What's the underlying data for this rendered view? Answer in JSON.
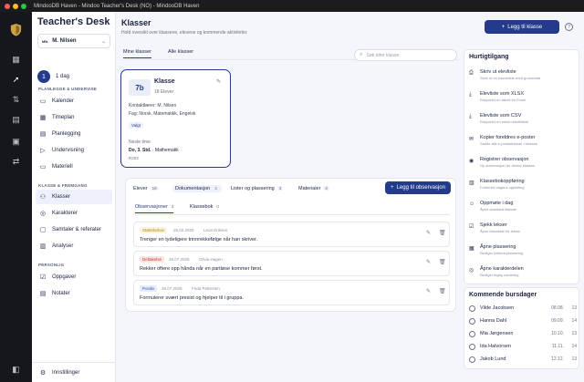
{
  "window": {
    "title": "MindooDB Haven - Mindoo Teacher's Desk (NO) - MindooDB Haven"
  },
  "colors": {
    "accent": "#243b8c",
    "tag_warning": "#b8860b",
    "tag_danger": "#c0392b",
    "tag_positive": "#2e4fb8"
  },
  "rail": {
    "logo": "shield-logo",
    "icons": [
      "grid-icon",
      "rocket-icon",
      "transfer-icon",
      "clipboard-icon",
      "inbox-icon",
      "swap-icon",
      "sidebar-toggle-icon"
    ]
  },
  "sidebar": {
    "brand_prefix": "Teacher's",
    "brand_suffix": "Desk",
    "user": {
      "initials": "MN",
      "name": "M. Nilsen"
    },
    "day": {
      "icon": "1",
      "label": "1 dag"
    },
    "sections": [
      {
        "title": "PLANLEGGE & UNDERVISE",
        "items": [
          {
            "label": "Kalender",
            "icon": "calendar-icon"
          },
          {
            "label": "Timeplan",
            "icon": "table-icon"
          },
          {
            "label": "Planlegging",
            "icon": "clipboard-icon"
          },
          {
            "label": "Undervisning",
            "icon": "play-icon"
          },
          {
            "label": "Materiell",
            "icon": "folder-icon"
          }
        ]
      },
      {
        "title": "KLASSE & FREMGANG",
        "items": [
          {
            "label": "Klasser",
            "icon": "users-icon",
            "active": true
          },
          {
            "label": "Karakterer",
            "icon": "grade-icon"
          },
          {
            "label": "Samtaler & referater",
            "icon": "chat-icon"
          },
          {
            "label": "Analyser",
            "icon": "chart-icon"
          }
        ]
      },
      {
        "title": "PERSONLIG",
        "items": [
          {
            "label": "Oppgaver",
            "icon": "check-icon"
          },
          {
            "label": "Notater",
            "icon": "note-icon"
          }
        ]
      }
    ],
    "footer": {
      "label": "Innstillinger",
      "icon": "gear-icon"
    }
  },
  "main": {
    "title": "Klasser",
    "subtitle": "Hold oversikt over klassene, elevene og kommende aktiviteter.",
    "add_class_label": "Legg til klasse",
    "tabs": [
      "Mine klasser",
      "Alle klasser"
    ],
    "search_placeholder": "Søk etter klasse",
    "class_card": {
      "badge": "7b",
      "name": "Klasse",
      "count": "18 Elever",
      "teacher": "Kontaktlærer: M. Nilsen",
      "subjects": "Fag: Norsk, Matematikk, Engelsk",
      "tag": "Valgt",
      "next_label": "Neste time",
      "next_day": "Do, 3. Std.",
      "next_subject": "Mathematik",
      "room": "R203"
    },
    "detail_tabs": [
      {
        "label": "Elever",
        "count": "18"
      },
      {
        "label": "Dokumentasjon",
        "count": "3",
        "active": true
      },
      {
        "label": "Lister og plassering",
        "count": "3"
      },
      {
        "label": "Materialer",
        "count": "0"
      }
    ],
    "add_observation_label": "Legg til observasjon",
    "sub_tabs": [
      {
        "label": "Observasjoner",
        "count": "3",
        "active": true
      },
      {
        "label": "Klassebok",
        "count": "0"
      }
    ],
    "observations": [
      {
        "tag": "Støttebehov",
        "tag_color": "tag_warning",
        "date": "26.02.2026",
        "author": "Leon Eriksen",
        "text": "Trenger en tydeligere trinnrekkefølge når han skriver."
      },
      {
        "tag": "Deltakelse",
        "tag_color": "tag_danger",
        "date": "26.07.2026",
        "author": "Olivia Hagen",
        "text": "Rekker oftere opp hånda når en partløse kommer først."
      },
      {
        "tag": "Positiv",
        "tag_color": "tag_positive",
        "date": "26.07.2026",
        "author": "Frida Pettersen",
        "text": "Formulerer svært presist og hjelper til i gruppa."
      }
    ]
  },
  "quick_access": {
    "title": "Hurtigtilgang",
    "items": [
      {
        "title": "Skriv ut elevliste",
        "subtitle": "Skriv ut en navneliste med grunndata",
        "icon": "printer-icon"
      },
      {
        "title": "Elevliste som XLSX",
        "subtitle": "Eksporter en tabell for Excel",
        "icon": "download-icon"
      },
      {
        "title": "Elevliste som CSV",
        "subtitle": "Eksporter en enkel tekstfilliste",
        "icon": "download-icon"
      },
      {
        "title": "Kopier foreldres e-poster",
        "subtitle": "Samle alle e-postadresser i klassen",
        "icon": "mail-icon"
      },
      {
        "title": "Registrer observasjon",
        "subtitle": "Ny observasjon for denne klassen",
        "icon": "eye-icon"
      },
      {
        "title": "Klassebokoppføring",
        "subtitle": "Forbered dagens oppføring",
        "icon": "book-icon"
      },
      {
        "title": "Oppmøte i dag",
        "subtitle": "Åpne standard-tilstede",
        "icon": "person-icon"
      },
      {
        "title": "Sjekk lekser",
        "subtitle": "Åpne lekseliste for lekser",
        "icon": "check-icon"
      },
      {
        "title": "Åpne plassering",
        "subtitle": "Rediger kollemt-plassering",
        "icon": "layout-icon"
      },
      {
        "title": "Åpne karakterdelen",
        "subtitle": "Rediger faglig vurdering",
        "icon": "grade-icon"
      }
    ]
  },
  "birthdays": {
    "title": "Kommende bursdager",
    "items": [
      {
        "name": "Vilde Jacobsen",
        "date": "08.08.",
        "age": "13"
      },
      {
        "name": "Hanna Dahl",
        "date": "09.09.",
        "age": "14"
      },
      {
        "name": "Mia Jørgensen",
        "date": "10.10.",
        "age": "13"
      },
      {
        "name": "Ida Halvorsen",
        "date": "11.11.",
        "age": "14"
      },
      {
        "name": "Jakob Lund",
        "date": "12.12.",
        "age": "13"
      }
    ]
  }
}
